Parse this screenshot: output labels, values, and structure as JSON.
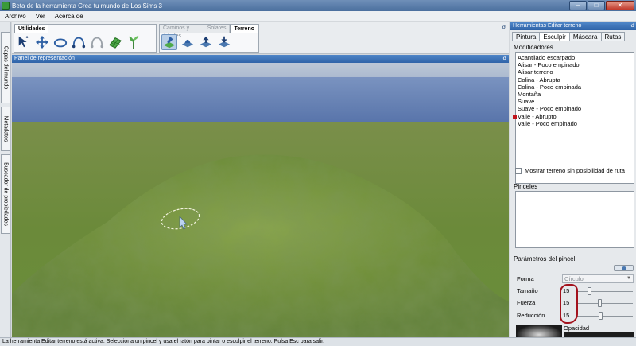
{
  "window": {
    "title": "Beta de la herramienta Crea tu mundo de Los Sims 3",
    "min_label": "–",
    "max_label": "□",
    "close_label": "✕"
  },
  "menu": [
    "Archivo",
    "Ver",
    "Acerca de"
  ],
  "left_tabs": [
    "Capas del mundo",
    "Metadatos",
    "Buscador de propiedades"
  ],
  "toolbar": {
    "group1_tabs": [
      "Utilidades"
    ],
    "group2_tabs": [
      "Caminos y árboles",
      "Solares",
      "Terreno"
    ],
    "pin": "ᑯ"
  },
  "viewport": {
    "title": "Panel de representación",
    "pin": "ᑯ"
  },
  "status": "La herramienta Editar terreno está activa. Selecciona un pincel y usa el ratón para pintar o esculpir el terreno. Pulsa Esc para salir.",
  "right_panel": {
    "title": "Herramientas Editar terreno",
    "pin": "ᑯ",
    "tabs": [
      "Pintura",
      "Esculpir",
      "Máscara",
      "Rutas"
    ],
    "active_tab": 1,
    "modifiers_label": "Modificadores",
    "modifiers": [
      "Acantilado escarpado",
      "Alisar - Poco empinado",
      "Alisar terreno",
      "Colina - Abrupta",
      "Colina - Poco empinada",
      "Montaña",
      "Suave",
      "Suave - Poco empinado",
      "Valle - Abrupto",
      "Valle - Poco empinado"
    ],
    "selected_modifier": 8,
    "route_checkbox_label": "Mostrar terreno sin posibilidad de ruta",
    "brushes_label": "Pinceles",
    "params_label": "Parámetros del pincel",
    "shape_label": "Forma",
    "shape_value": "Círculo",
    "params": [
      {
        "label": "Tamaño",
        "value": "15",
        "level": 0.2
      },
      {
        "label": "Fuerza",
        "value": "15",
        "level": 0.4
      },
      {
        "label": "Reducción",
        "value": "15",
        "level": 0.42
      }
    ],
    "opacity_label": "Opacidad"
  },
  "colors": {
    "accent_blue": "#2f63a8",
    "terrain_green": "#6b8a3a",
    "water_blue": "#5e7fb3",
    "annotation_red": "#a3121d"
  }
}
